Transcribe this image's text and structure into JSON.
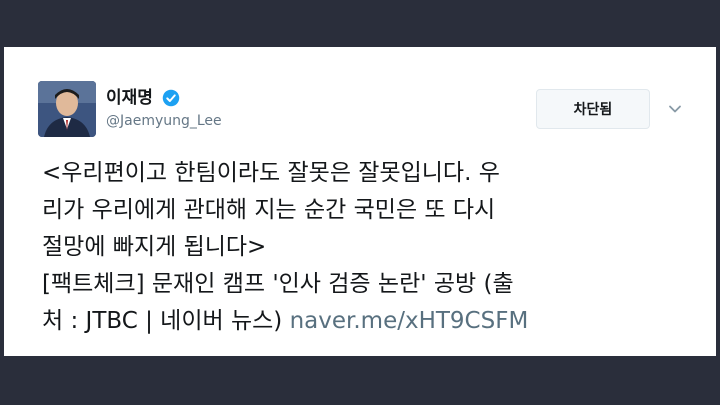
{
  "tweet": {
    "display_name": "이재명",
    "handle": "@Jaemyung_Lee",
    "blocked_label": "차단됨",
    "text_lines": [
      "<우리편이고 한팀이라도 잘못은 잘못입니다. 우",
      "리가 우리에게 관대해 지는 순간 국민은 또 다시",
      "절망에 빠지게 됩니다>",
      "[팩트체크] 문재인 캠프 '인사 검증 논란' 공방 (출",
      "처 : JTBC | 네이버 뉴스) "
    ],
    "link_text": "naver.me/xHT9CSFM"
  },
  "colors": {
    "background": "#2a2e3b",
    "card": "#ffffff",
    "verified": "#1da1f2",
    "link": "#58707f"
  }
}
